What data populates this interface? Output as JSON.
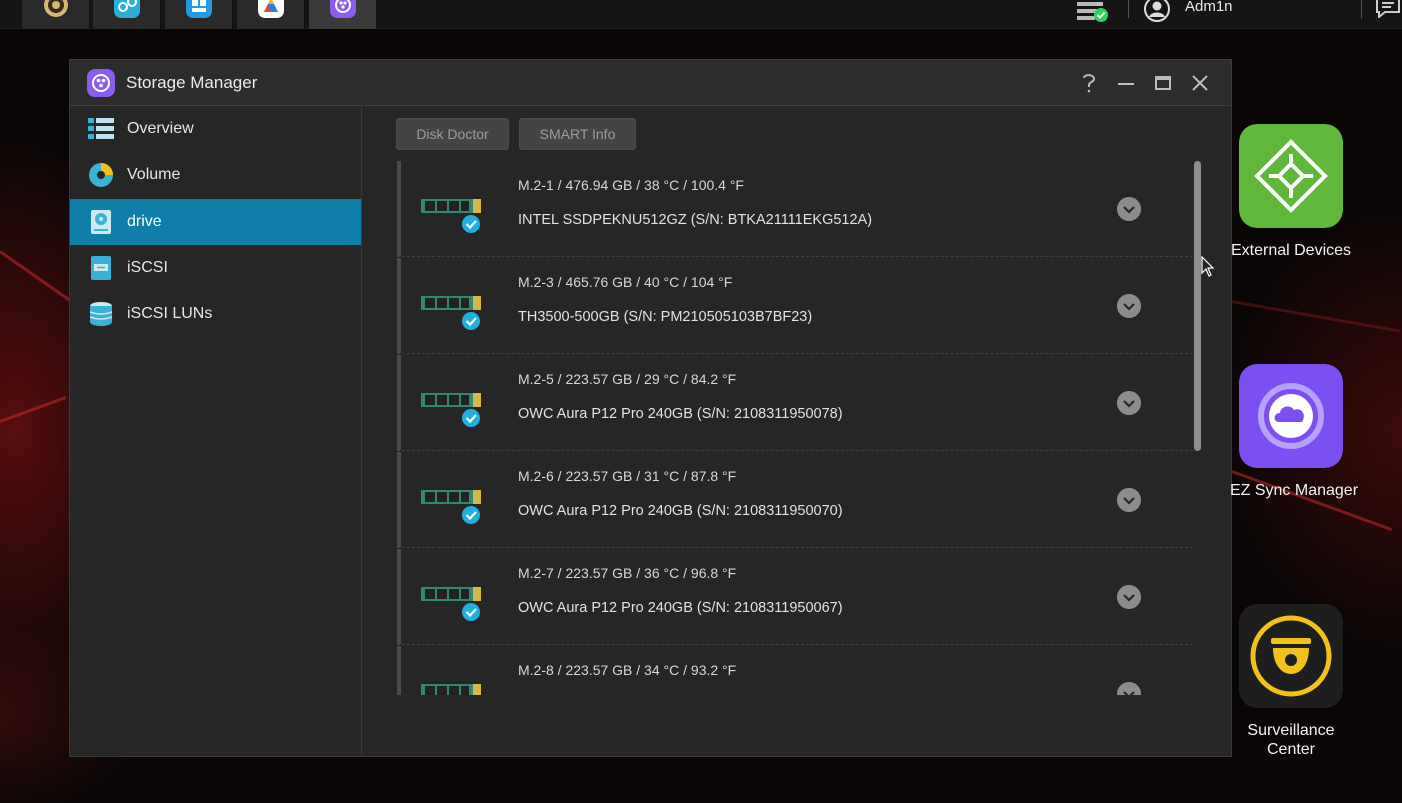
{
  "taskbar": {
    "user_name": "Adm1n",
    "apps": [
      "settings-app",
      "network-app",
      "app-center",
      "drive-app",
      "storage-manager"
    ]
  },
  "window": {
    "title": "Storage Manager",
    "help": "?"
  },
  "sidebar": {
    "items": [
      {
        "label": "Overview",
        "icon": "overview-icon"
      },
      {
        "label": "Volume",
        "icon": "volume-icon"
      },
      {
        "label": "drive",
        "icon": "drive-icon",
        "active": true
      },
      {
        "label": "iSCSI",
        "icon": "iscsi-icon"
      },
      {
        "label": "iSCSI LUNs",
        "icon": "iscsi-luns-icon"
      }
    ]
  },
  "toolbar": {
    "disk_doctor": "Disk Doctor",
    "smart_info": "SMART Info"
  },
  "drives": [
    {
      "summary": "M.2-1 / 476.94 GB / 38 °C / 100.4 °F",
      "model": "INTEL SSDPEKNU512GZ (S/N: BTKA21111EKG512A)"
    },
    {
      "summary": "M.2-3 / 465.76 GB / 40 °C / 104 °F",
      "model": "TH3500-500GB (S/N: PM210505103B7BF23)"
    },
    {
      "summary": "M.2-5 / 223.57 GB / 29 °C / 84.2 °F",
      "model": "OWC Aura P12 Pro 240GB (S/N: 2108311950078)"
    },
    {
      "summary": "M.2-6 / 223.57 GB / 31 °C / 87.8 °F",
      "model": "OWC Aura P12 Pro 240GB (S/N: 2108311950070)"
    },
    {
      "summary": "M.2-7 / 223.57 GB / 36 °C / 96.8 °F",
      "model": "OWC Aura P12 Pro 240GB (S/N: 2108311950067)"
    },
    {
      "summary": "M.2-8 / 223.57 GB / 34 °C / 93.2 °F",
      "model": ""
    }
  ],
  "desktop": {
    "external_devices": "External Devices",
    "ez_sync": "EZ Sync Manager",
    "surveillance_1": "Surveillance",
    "surveillance_2": "Center"
  },
  "colors": {
    "accent": "#0f7ea8",
    "status_ok": "#1fb0e0",
    "storage_manager_brand": "#8b5cf0",
    "external_devices": "#5fb83a",
    "ez_sync": "#7b4ff0",
    "surveillance": "#f2c21b"
  }
}
